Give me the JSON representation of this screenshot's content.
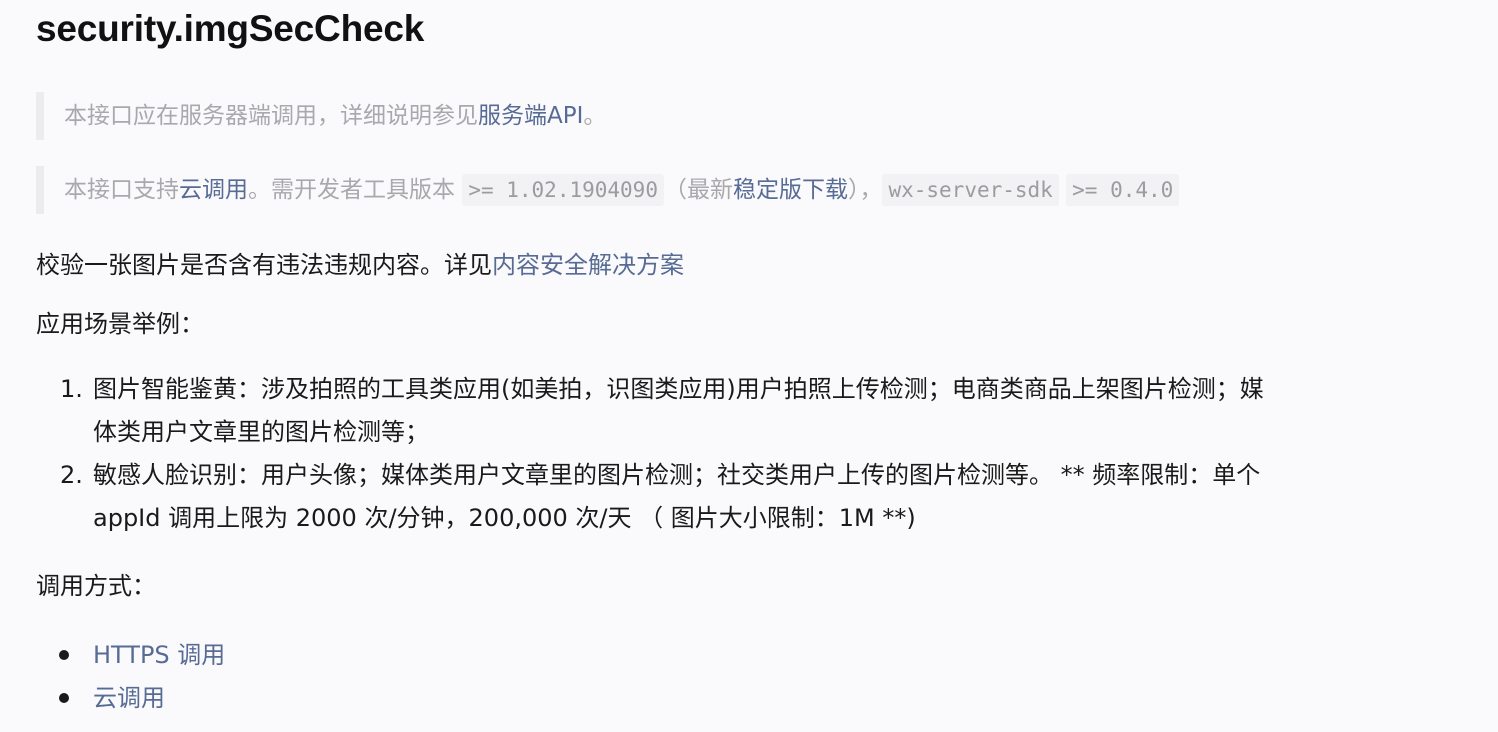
{
  "title": "security.imgSecCheck",
  "note1": {
    "prefix": "本接口应在服务器端调用，详细说明参见",
    "link": "服务端API",
    "suffix": "。"
  },
  "note2": {
    "prefix": "本接口支持",
    "link1": "云调用",
    "mid1": "。需开发者工具版本 ",
    "code1": ">= 1.02.1904090",
    "mid2": "（最新",
    "link2": "稳定版下载",
    "mid3": "），",
    "code2": "wx-server-sdk",
    "mid4": " ",
    "code3": ">= 0.4.0"
  },
  "description": {
    "text": "校验一张图片是否含有违法违规内容。详见",
    "link": "内容安全解决方案"
  },
  "scenes_label": "应用场景举例：",
  "scenarios": [
    {
      "num": "1.",
      "line1": "图片智能鉴黄：涉及拍照的工具类应用(如美拍，识图类应用)用户拍照上传检测；电商类商品上架图片检测；媒",
      "line2": "体类用户文章里的图片检测等；"
    },
    {
      "num": "2.",
      "line1": "敏感人脸识别：用户头像；媒体类用户文章里的图片检测；社交类用户上传的图片检测等。 ** 频率限制：单个",
      "line2": "appId 调用上限为 2000 次/分钟，200,000 次/天 （ 图片大小限制：1M **)"
    }
  ],
  "call_label": "调用方式：",
  "call_methods": [
    {
      "label": "HTTPS 调用"
    },
    {
      "label": "云调用"
    }
  ]
}
